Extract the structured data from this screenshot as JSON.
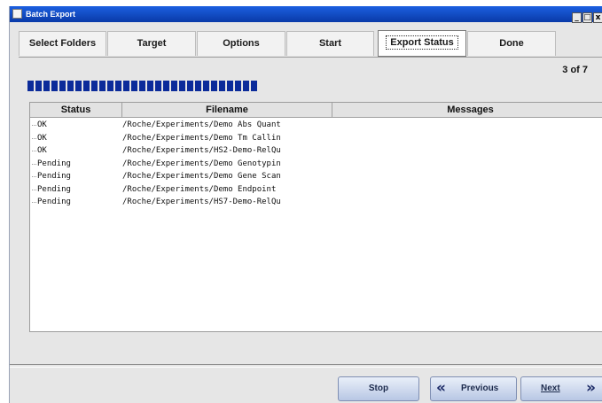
{
  "window": {
    "title": "Batch Export",
    "controls": {
      "minimize": "_",
      "maximize": "□",
      "close": "x"
    }
  },
  "tabs": [
    {
      "label": "Select Folders"
    },
    {
      "label": "Target"
    },
    {
      "label": "Options"
    },
    {
      "label": "Start"
    },
    {
      "label": "Export Status",
      "active": true
    },
    {
      "label": "Done"
    }
  ],
  "progress": {
    "counter_text": "3 of 7",
    "fraction": 0.43
  },
  "table": {
    "columns": [
      "Status",
      "Filename",
      "Messages"
    ],
    "rows": [
      {
        "status": "OK",
        "filename": "/Roche/Experiments/Demo Abs Quant",
        "message": ""
      },
      {
        "status": "OK",
        "filename": "/Roche/Experiments/Demo Tm Callin",
        "message": ""
      },
      {
        "status": "OK",
        "filename": "/Roche/Experiments/HS2-Demo-RelQu",
        "message": ""
      },
      {
        "status": "Pending",
        "filename": "/Roche/Experiments/Demo Genotypin",
        "message": ""
      },
      {
        "status": "Pending",
        "filename": "/Roche/Experiments/Demo Gene Scan",
        "message": ""
      },
      {
        "status": "Pending",
        "filename": "/Roche/Experiments/Demo Endpoint",
        "message": ""
      },
      {
        "status": "Pending",
        "filename": "/Roche/Experiments/HS7-Demo-RelQu",
        "message": ""
      }
    ]
  },
  "buttons": {
    "stop": "Stop",
    "previous": "Previous",
    "next": "Next",
    "previous_icon": "chevron-double-left-icon",
    "next_icon": "chevron-double-right-icon"
  },
  "colors": {
    "titlebar": "#0a3aa8",
    "progress": "#0b2b9a",
    "button": "#b8c7e4"
  }
}
